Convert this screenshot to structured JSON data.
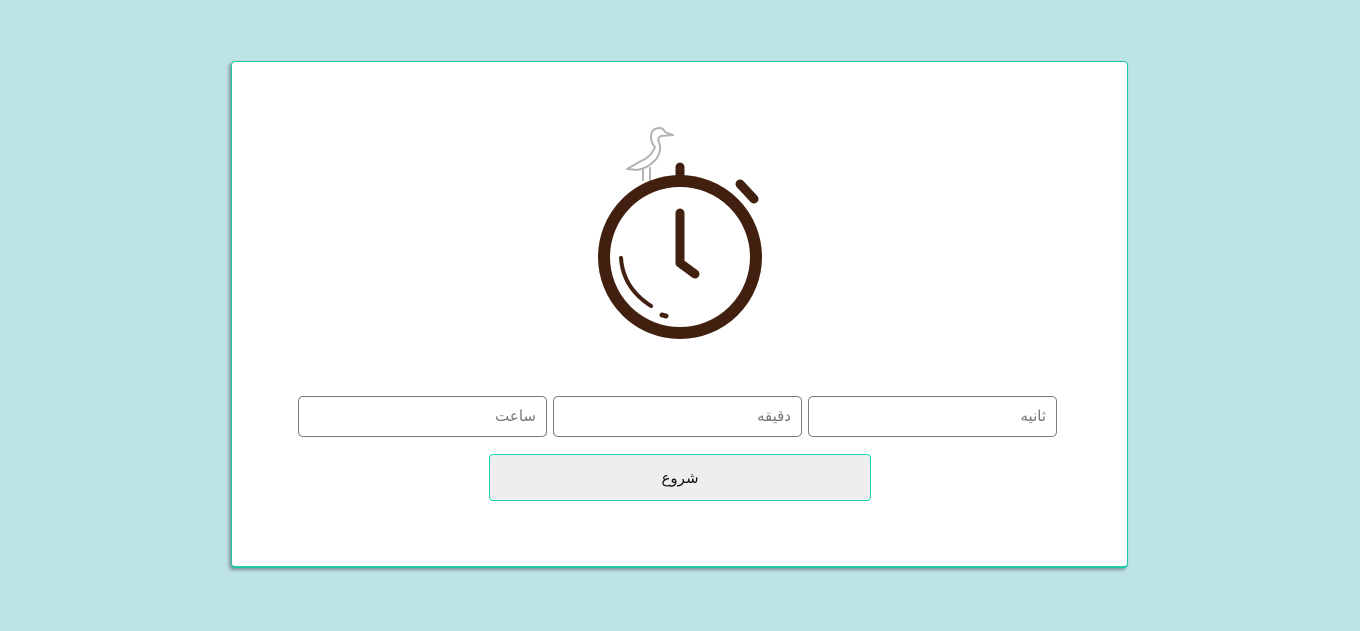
{
  "timer": {
    "hours_placeholder": "ساعت",
    "minutes_placeholder": "دقیقه",
    "seconds_placeholder": "ثانیه",
    "start_label": "شروع"
  },
  "colors": {
    "background": "#bde3e5",
    "accent": "#1ec8a5",
    "stopwatch": "#42200f",
    "bird": "#b3b3b3"
  },
  "icons": {
    "logo": "stopwatch-icon",
    "mascot": "heron-icon"
  }
}
